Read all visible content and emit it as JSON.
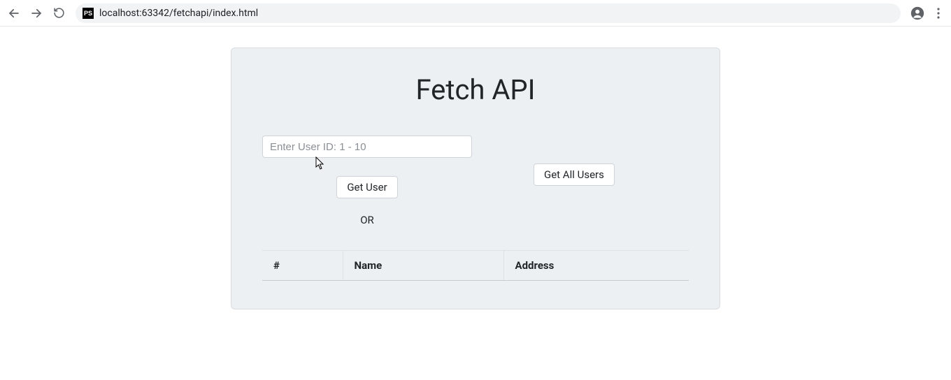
{
  "browser": {
    "url": "localhost:63342/fetchapi/index.html",
    "favicon_label": "PS"
  },
  "page": {
    "title": "Fetch API",
    "user_id_placeholder": "Enter User ID: 1 - 10",
    "get_user_label": "Get User",
    "or_label": "OR",
    "get_all_label": "Get All Users",
    "table": {
      "col_id": "#",
      "col_name": "Name",
      "col_address": "Address"
    }
  }
}
